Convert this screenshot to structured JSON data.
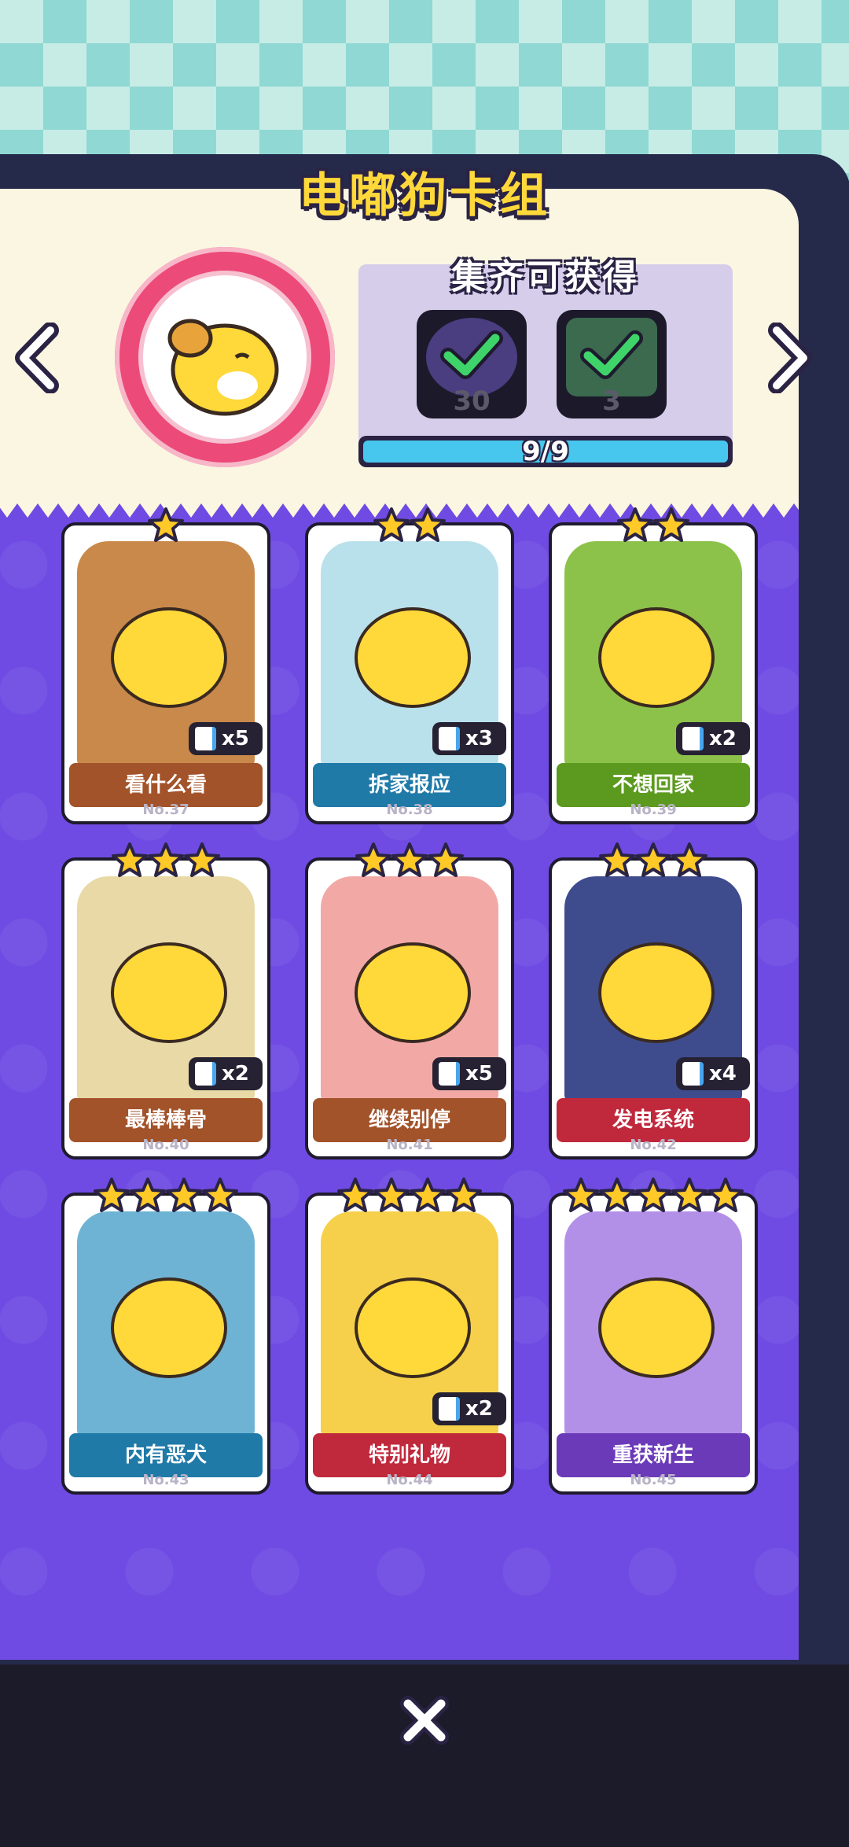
{
  "header": {
    "title": "电嘟狗卡组"
  },
  "rewards": {
    "title": "集齐可获得",
    "items": [
      {
        "icon": "avatar-frame-icon",
        "count": "30"
      },
      {
        "icon": "card-back-icon",
        "count": "3"
      }
    ],
    "progress_text": "9/9",
    "progress_fraction": 1.0
  },
  "cards": [
    {
      "name": "看什么看",
      "number": "No.37",
      "stars": 1,
      "count": "x5",
      "ribbon_color": "#a3532a",
      "art_color": "#c9894a"
    },
    {
      "name": "拆家报应",
      "number": "No.38",
      "stars": 2,
      "count": "x3",
      "ribbon_color": "#1f7aa8",
      "art_color": "#b9e1ec"
    },
    {
      "name": "不想回家",
      "number": "No.39",
      "stars": 2,
      "count": "x2",
      "ribbon_color": "#5c9a1f",
      "art_color": "#8cc24a"
    },
    {
      "name": "最棒棒骨",
      "number": "No.40",
      "stars": 3,
      "count": "x2",
      "ribbon_color": "#a3532a",
      "art_color": "#e8d9a6"
    },
    {
      "name": "继续别停",
      "number": "No.41",
      "stars": 3,
      "count": "x5",
      "ribbon_color": "#a3532a",
      "art_color": "#f2a9a6"
    },
    {
      "name": "发电系统",
      "number": "No.42",
      "stars": 3,
      "count": "x4",
      "ribbon_color": "#c0283c",
      "art_color": "#3e4c8e"
    },
    {
      "name": "内有恶犬",
      "number": "No.43",
      "stars": 4,
      "count": "",
      "ribbon_color": "#1f7aa8",
      "art_color": "#6fb3d4"
    },
    {
      "name": "特别礼物",
      "number": "No.44",
      "stars": 4,
      "count": "x2",
      "ribbon_color": "#c0283c",
      "art_color": "#f6d04a"
    },
    {
      "name": "重获新生",
      "number": "No.45",
      "stars": 5,
      "count": "",
      "ribbon_color": "#6b3ab8",
      "art_color": "#b390e8"
    }
  ],
  "colors": {
    "accent_yellow": "#ffd83a",
    "panel_purple": "#6f4be3",
    "progress_blue": "#47c7ee"
  }
}
